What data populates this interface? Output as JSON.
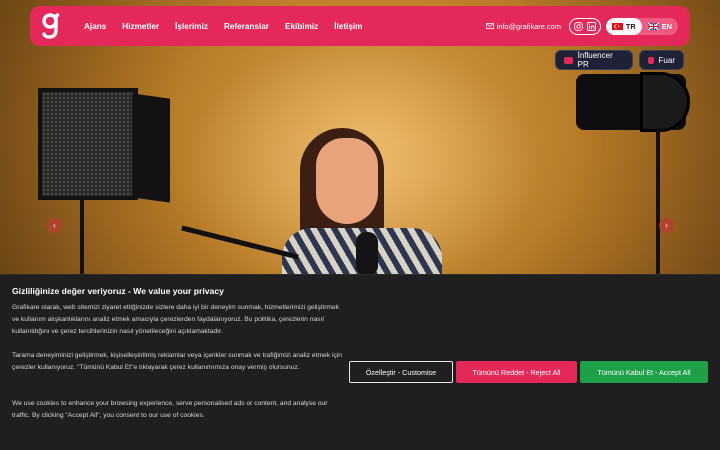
{
  "nav": {
    "links": [
      "Ajans",
      "Hizmetler",
      "İşlerimiz",
      "Referanslar",
      "Ekibimiz",
      "İletişim"
    ],
    "email": "info@grafikare.com",
    "languages": [
      {
        "code": "TR",
        "active": true
      },
      {
        "code": "EN",
        "active": false
      }
    ],
    "social_icons": [
      "instagram-icon",
      "linkedin-icon"
    ]
  },
  "pills": {
    "influencer": "İnfluencer PR",
    "fuar": "Fuar"
  },
  "slider": {
    "prev": "‹",
    "next": "›"
  },
  "cookie": {
    "title": "Gizliliğinize değer veriyoruz - We value your privacy",
    "paragraph1": "Grafikare olarak, web sitemizi ziyaret ettiğinizde sizlere daha iyi bir deneyim sunmak, hizmetlerimizi geliştirmek ve kullanım alışkanlıklarını analiz etmek amacıyla çerezlerden faydalanıyoruz. Bu politika, çerezlerin nasıl kullanıldığını ve çerez tercihlerinizin nasıl yönetileceğini açıklamaktadır.",
    "paragraph2": "Tarama deneyiminizi geliştirmek, kişiselleştirilmiş reklamlar veya içerikler sunmak ve trafiğimizi analiz etmek için çerezler kullanıyoruz. \"Tümünü Kabul Et\"e tıklayarak çerez kullanımımıza onay vermiş olursunuz.",
    "paragraph3": "We use cookies to enhance your browsing experience, serve personalised ads or content, and analyse our traffic. By clicking \"Accept All\", you consent to our use of cookies.",
    "customise": "Özelleştir - Customise",
    "reject": "Tümünü Reddet - Reject All",
    "accept": "Tümünü Kabul Et - Accept All"
  },
  "colors": {
    "brand": "#e5285a",
    "accept": "#1ea046",
    "banner": "#1f1f1f"
  }
}
